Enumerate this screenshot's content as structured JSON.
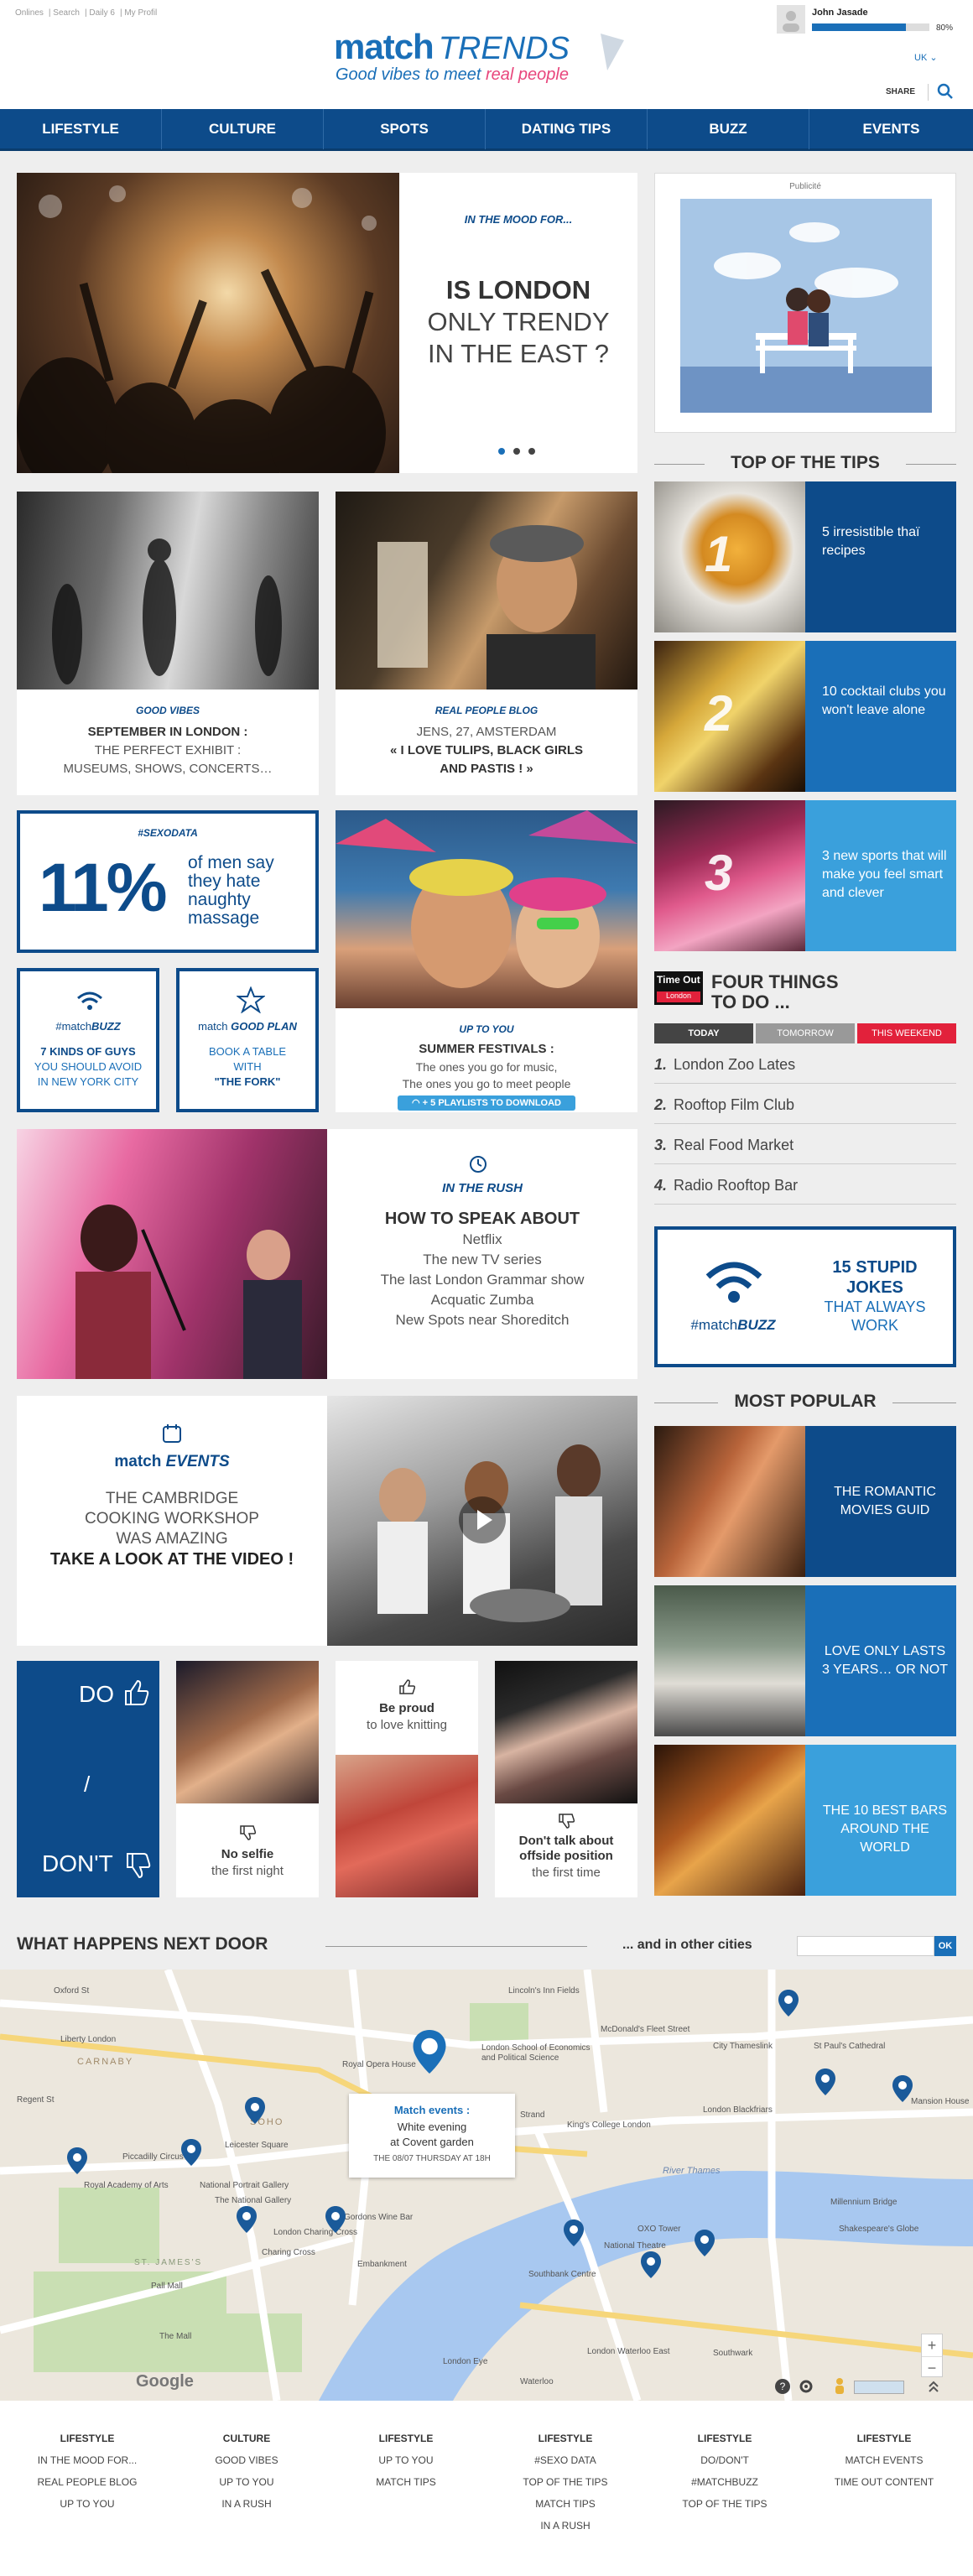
{
  "top_links": [
    "Onlines",
    "Search",
    "Daily 6",
    "My Profil"
  ],
  "logo": {
    "match": "match",
    "trends": "TRENDS",
    "tagline_a": "Good vibes to meet ",
    "tagline_b": "real people"
  },
  "user": {
    "name": "John Jasade",
    "progress": 0.8,
    "progress_label": "80%"
  },
  "lang": "UK",
  "share": "SHARE",
  "nav": [
    "LIFESTYLE",
    "CULTURE",
    "SPOTS",
    "DATING TIPS",
    "BUZZ",
    "EVENTS"
  ],
  "hero": {
    "kicker": "IN THE MOOD FOR...",
    "title_a": "IS LONDON",
    "title_b": "ONLY TRENDY",
    "title_c": "IN THE EAST ?"
  },
  "ad": {
    "label": "Publicité"
  },
  "top_tips": {
    "title": "TOP OF THE TIPS",
    "items": [
      {
        "num": "1",
        "text": "5 irresistible thaï recipes"
      },
      {
        "num": "2",
        "text": "10 cocktail clubs you won't leave alone"
      },
      {
        "num": "3",
        "text": "3 new sports that will make you feel smart and clever"
      }
    ]
  },
  "good_vibes": {
    "kicker": "GOOD VIBES",
    "line1": "SEPTEMBER IN LONDON :",
    "line2": "THE PERFECT EXHIBIT :",
    "line3": "MUSEUMS, SHOWS, CONCERTS…"
  },
  "blog": {
    "kicker": "REAL PEOPLE BLOG",
    "line1": "JENS, 27, AMSTERDAM",
    "line2": "« I LOVE TULIPS, BLACK GIRLS",
    "line3": "AND PASTIS ! »"
  },
  "sexodata": {
    "kicker": "#SEXODATA",
    "pct": "11%",
    "text": "of men say they hate naughty massage"
  },
  "matchbuzz_small": {
    "kicker_a": "#match",
    "kicker_b": "BUZZ",
    "line1": "7 KINDS OF GUYS",
    "line2": "YOU SHOULD AVOID",
    "line3": "IN NEW YORK CITY"
  },
  "goodplan": {
    "kicker_a": "match",
    "kicker_b": "GOOD PLAN",
    "line1": "BOOK A TABLE",
    "line2": "WITH",
    "line3": "\"THE FORK\""
  },
  "festivals": {
    "kicker": "UP TO YOU",
    "title": "SUMMER FESTIVALS :",
    "line1": "The ones you go for music,",
    "line2": "The ones you go to meet people",
    "button": "+ 5 PLAYLISTS TO DOWNLOAD"
  },
  "timeout": {
    "logo_a": "Time Out",
    "logo_b": "London",
    "title_a": "FOUR THINGS",
    "title_b": "TO DO ...",
    "tabs": [
      "TODAY",
      "TOMORROW",
      "THIS WEEKEND"
    ],
    "items": [
      {
        "num": "1.",
        "text": "London Zoo Lates"
      },
      {
        "num": "2.",
        "text": "Rooftop Film Club"
      },
      {
        "num": "3.",
        "text": "Real Food Market"
      },
      {
        "num": "4.",
        "text": "Radio Rooftop Bar"
      }
    ]
  },
  "rush": {
    "kicker": "IN THE RUSH",
    "title": "HOW TO SPEAK ABOUT",
    "items": [
      "Netflix",
      "The new TV series",
      "The last London Grammar show",
      "Acquatic Zumba",
      "New Spots near Shoreditch"
    ]
  },
  "buzz_big": {
    "line1": "15 STUPID",
    "line2": "JOKES",
    "line3": "THAT ALWAYS",
    "line4": "WORK",
    "kicker_a": "#match",
    "kicker_b": "BUZZ"
  },
  "events": {
    "kicker_a": "match",
    "kicker_b": "EVENTS",
    "line1": "THE CAMBRIDGE",
    "line2": "COOKING WORKSHOP",
    "line3": "WAS AMAZING",
    "line4": "TAKE A LOOK AT THE VIDEO !"
  },
  "most_popular": {
    "title": "MOST POPULAR",
    "items": [
      "THE ROMANTIC MOVIES GUID",
      "LOVE ONLY LASTS 3 YEARS… OR NOT",
      "THE 10 BEST BARS AROUND THE WORLD"
    ]
  },
  "dodont": {
    "do": "DO",
    "slash": "/",
    "dont": "DON'T",
    "items": [
      {
        "title": "No selfie",
        "sub": "the first night"
      },
      {
        "title": "Be proud",
        "sub": "to love knitting"
      },
      {
        "title": "Don't talk about offside position",
        "sub": "the first time"
      }
    ]
  },
  "next_door": {
    "title": "WHAT HAPPENS NEXT DOOR",
    "other": "... and in other cities",
    "ok": "OK"
  },
  "map": {
    "callout_title": "Match events :",
    "callout_line1": "White evening",
    "callout_line2": "at Covent garden",
    "callout_line3": "THE 08/07 THURSDAY AT 18H",
    "labels": [
      "Oxford St",
      "Liberty London",
      "CARNABY",
      "Regent St",
      "Piccadilly Circus",
      "Royal Academy of Arts",
      "National Portrait Gallery",
      "The National Gallery",
      "London Charing Cross",
      "Charing Cross",
      "Gordons Wine Bar",
      "Embankment",
      "Royal Opera House",
      "London School of Economics and Political Science",
      "Lincoln's Inn Fields",
      "McDonald's Fleet Street",
      "City Thameslink",
      "St Paul's Cathedral",
      "London Blackfriars",
      "Millennium Bridge",
      "Shakespeare's Globe",
      "River Thames",
      "OXO Tower",
      "Southbank Centre",
      "London Eye",
      "London Waterloo East",
      "Waterloo",
      "SOHO",
      "Leicester Square",
      "Strand",
      "King's College London",
      "Mansion House",
      "Southwark",
      "Pall Mall",
      "The Mall",
      "National Theatre",
      "ST. JAMES'S"
    ],
    "google": "Google"
  },
  "footer": [
    {
      "head": "LIFESTYLE",
      "items": [
        "IN THE MOOD FOR...",
        "REAL PEOPLE BLOG",
        "UP TO YOU"
      ]
    },
    {
      "head": "CULTURE",
      "items": [
        "GOOD VIBES",
        "UP TO YOU",
        "IN A RUSH"
      ]
    },
    {
      "head": "LIFESTYLE",
      "items": [
        "UP TO YOU",
        "MATCH TIPS"
      ]
    },
    {
      "head": "LIFESTYLE",
      "items": [
        "#SEXO DATA",
        "TOP OF THE TIPS",
        "MATCH TIPS",
        "IN A RUSH"
      ]
    },
    {
      "head": "LIFESTYLE",
      "items": [
        "DO/DON'T",
        "#MATCHBUZZ",
        "TOP OF THE TIPS"
      ]
    },
    {
      "head": "LIFESTYLE",
      "items": [
        "MATCH EVENTS",
        "TIME OUT CONTENT"
      ]
    }
  ],
  "colors": {
    "navy": "#0d4b8a",
    "blue": "#1a6fb8",
    "light_blue": "#3aa0dc",
    "pink": "#e8467c"
  }
}
